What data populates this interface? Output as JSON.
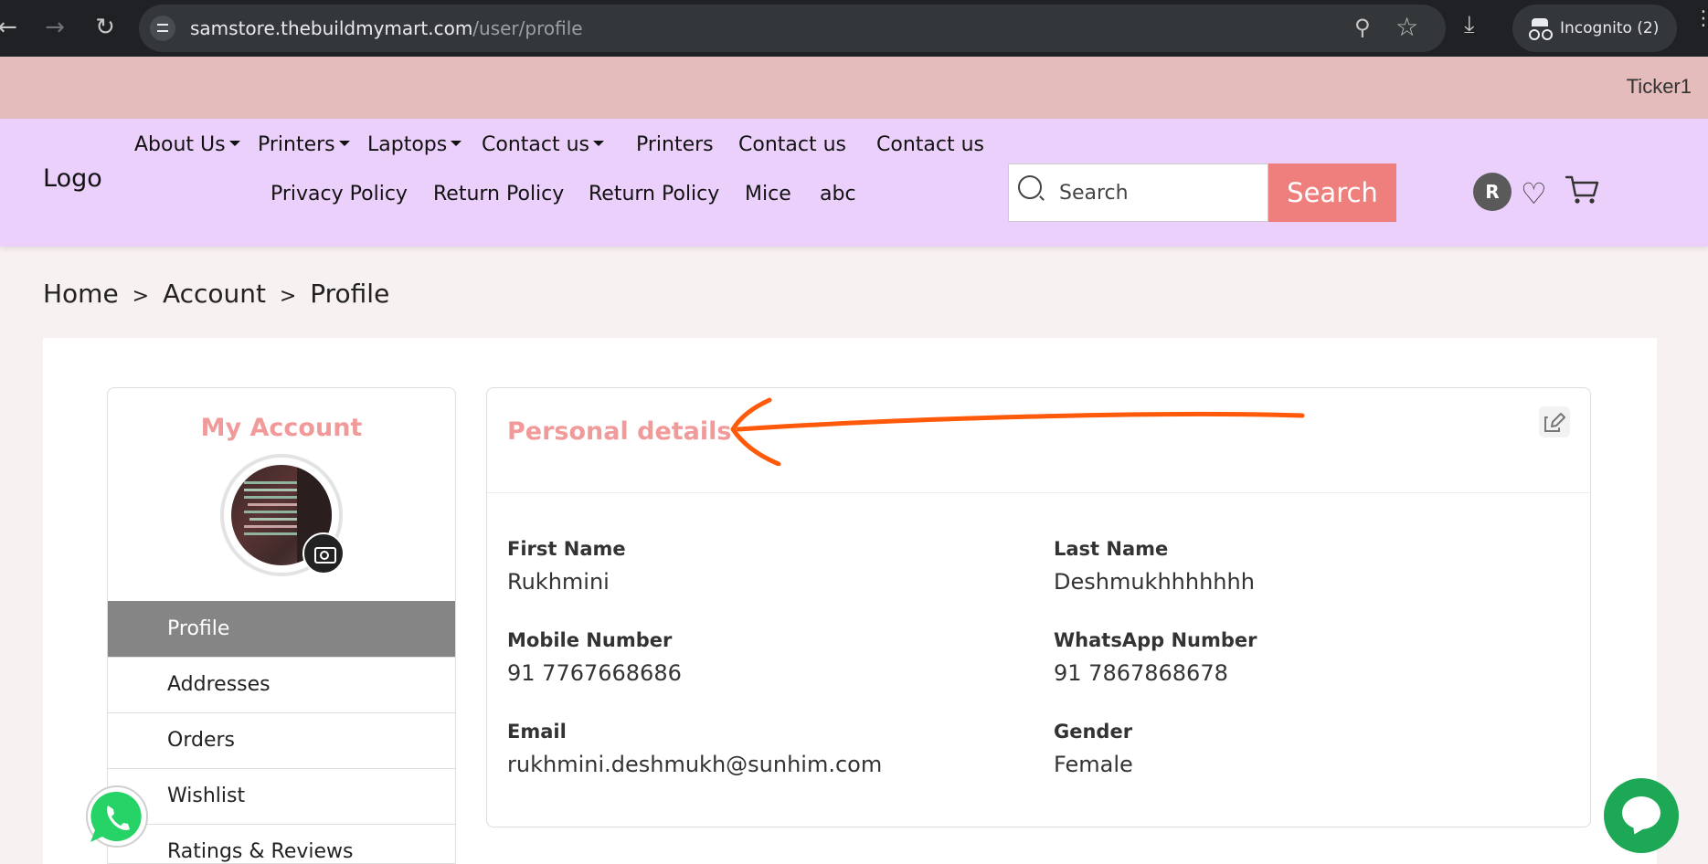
{
  "browser": {
    "url_host": "samstore.thebuildmymart.com",
    "url_path": "/user/profile",
    "incognito_label": "Incognito (2)"
  },
  "ticker": {
    "text": "Ticker1"
  },
  "header": {
    "logo": "Logo",
    "nav_row1": [
      {
        "label": "About Us",
        "dropdown": true
      },
      {
        "label": "Printers",
        "dropdown": true
      },
      {
        "label": "Laptops",
        "dropdown": true
      },
      {
        "label": "Contact us",
        "dropdown": true
      },
      {
        "label": "Printers",
        "dropdown": false
      },
      {
        "label": "Contact us",
        "dropdown": false
      },
      {
        "label": "Contact us",
        "dropdown": false
      }
    ],
    "nav_row2": [
      {
        "label": "Privacy Policy"
      },
      {
        "label": "Return Policy"
      },
      {
        "label": "Return Policy"
      },
      {
        "label": "Mice"
      },
      {
        "label": "abc"
      }
    ],
    "search": {
      "placeholder": "Search",
      "button_label": "Search"
    },
    "avatar_initial": "R"
  },
  "breadcrumb": [
    "Home",
    "Account",
    "Profile"
  ],
  "sidebar": {
    "title": "My Account",
    "items": [
      {
        "label": "Profile",
        "active": true
      },
      {
        "label": "Addresses",
        "active": false
      },
      {
        "label": "Orders",
        "active": false
      },
      {
        "label": "Wishlist",
        "active": false
      },
      {
        "label": "Ratings & Reviews",
        "active": false
      }
    ]
  },
  "details": {
    "title": "Personal details",
    "fields": [
      {
        "label": "First Name",
        "value": "Rukhmini"
      },
      {
        "label": "Last Name",
        "value": "Deshmukhhhhhhh"
      },
      {
        "label": "Mobile Number",
        "value": "91 7767668686"
      },
      {
        "label": "WhatsApp Number",
        "value": "91 7867868678"
      },
      {
        "label": "Email",
        "value": "rukhmini.deshmukh@sunhim.com"
      },
      {
        "label": "Gender",
        "value": "Female"
      }
    ]
  },
  "colors": {
    "ticker_bg": "#e3bcbb",
    "header_bg": "#ecd0fc",
    "accent": "#ef7f7c",
    "title_pink": "#f09b9a",
    "annotation_orange": "#ff5a0a",
    "whatsapp_green": "#25d366",
    "chat_green": "#1da855"
  }
}
